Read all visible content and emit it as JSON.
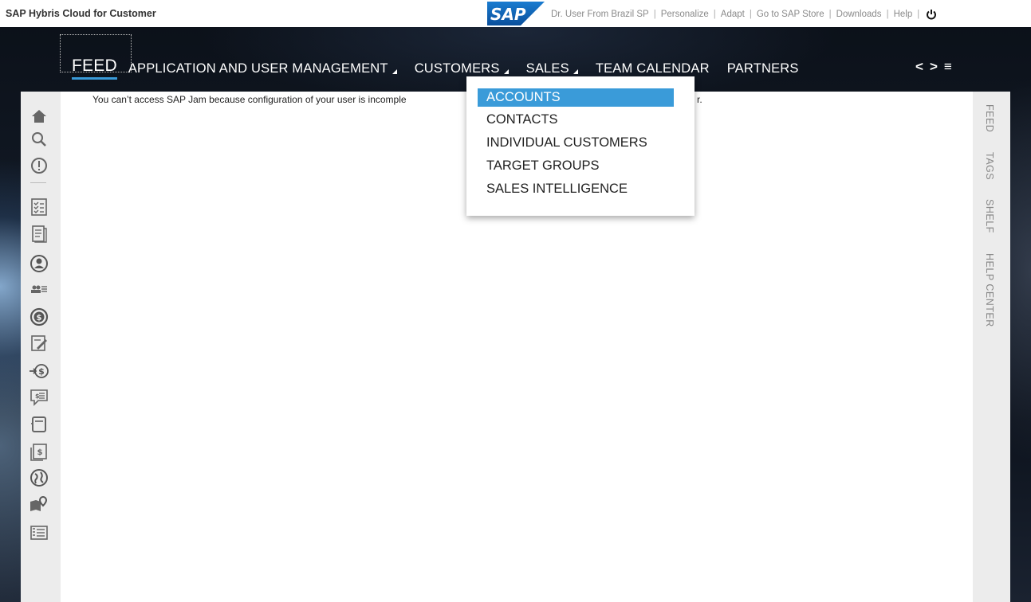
{
  "header": {
    "app_title": "SAP Hybris Cloud for Customer",
    "logo_text": "SAP",
    "links": [
      "Dr. User From Brazil SP",
      "Personalize",
      "Adapt",
      "Go to SAP Store",
      "Downloads",
      "Help"
    ],
    "separator": "|"
  },
  "nav": {
    "items": [
      {
        "label": "FEED",
        "active": true,
        "has_menu": false
      },
      {
        "label": "APPLICATION AND USER MANAGEMENT",
        "active": false,
        "has_menu": true
      },
      {
        "label": "CUSTOMERS",
        "active": false,
        "has_menu": true
      },
      {
        "label": "SALES",
        "active": false,
        "has_menu": true
      },
      {
        "label": "TEAM CALENDAR",
        "active": false,
        "has_menu": false
      },
      {
        "label": "PARTNERS",
        "active": false,
        "has_menu": false
      }
    ],
    "prev_glyph": "<",
    "next_glyph": ">",
    "overflow_glyph": "≡",
    "accent_color": "#3a9bd9"
  },
  "dropdown": {
    "items": [
      "ACCOUNTS",
      "CONTACTS",
      "INDIVIDUAL CUSTOMERS",
      "TARGET GROUPS",
      "SALES INTELLIGENCE"
    ],
    "selected": "ACCOUNTS"
  },
  "main": {
    "message_start": "You can’t access SAP Jam because configuration of your user is incomple",
    "message_end": "r."
  },
  "left_icons": [
    "home-icon",
    "search-icon",
    "alert-icon",
    "checklist-icon",
    "document-icon",
    "person-icon",
    "team-list-icon",
    "dollar-icon",
    "edit-report-icon",
    "transfer-dollar-icon",
    "quote-icon",
    "book-icon",
    "invoice-icon",
    "globe-icon",
    "map-pin-icon",
    "list-icon"
  ],
  "right_tabs": [
    "FEED",
    "TAGS",
    "SHELF",
    "HELP CENTER"
  ]
}
